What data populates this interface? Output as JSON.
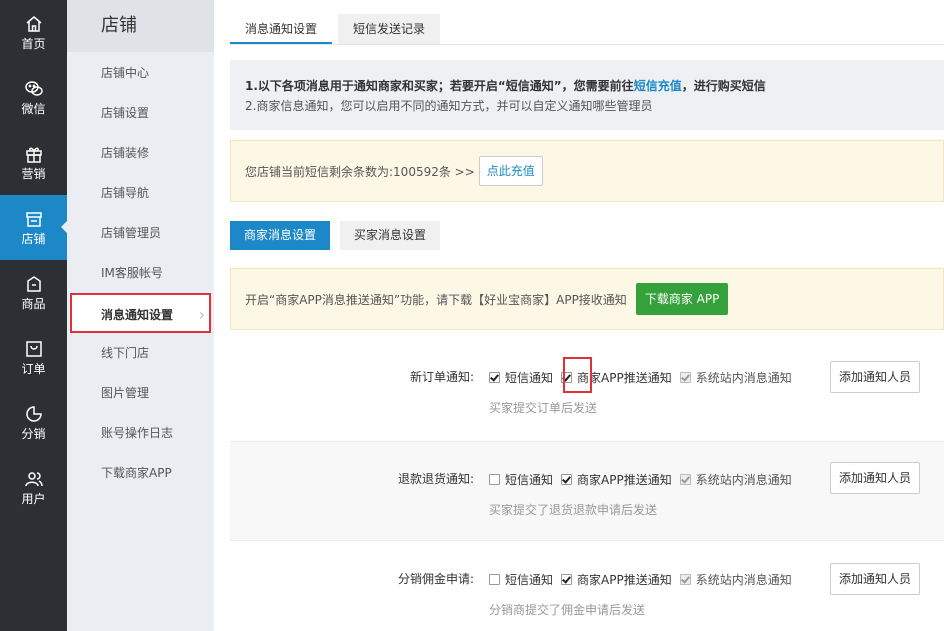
{
  "nav": [
    {
      "label": "首页",
      "icon": "home-icon"
    },
    {
      "label": "微信",
      "icon": "wechat-icon"
    },
    {
      "label": "营销",
      "icon": "gift-icon"
    },
    {
      "label": "店铺",
      "icon": "store-icon"
    },
    {
      "label": "商品",
      "icon": "bag-icon"
    },
    {
      "label": "订单",
      "icon": "order-icon"
    },
    {
      "label": "分销",
      "icon": "chart-icon"
    },
    {
      "label": "用户",
      "icon": "users-icon"
    }
  ],
  "submenu": {
    "title": "店铺",
    "items": [
      "店铺中心",
      "店铺设置",
      "店铺装修",
      "店铺导航",
      "店铺管理员",
      "IM客服帐号",
      "消息通知设置",
      "线下门店",
      "图片管理",
      "账号操作日志",
      "下载商家APP"
    ]
  },
  "tabs": [
    "消息通知设置",
    "短信发送记录"
  ],
  "notice": {
    "line1_a": "1.以下各项消息用于通知商家和买家；若要开启“短信通知”，您需要前往",
    "line1_link": "短信充值",
    "line1_b": "，进行购买短信",
    "line2": "2.商家信息通知，您可以启用不同的通知方式，并可以自定义通知哪些管理员"
  },
  "balance": {
    "text": "您店铺当前短信剩余条数为:100592条 >>",
    "button": "点此充值"
  },
  "subtabs": [
    "商家消息设置",
    "买家消息设置"
  ],
  "app_notice": {
    "text": "开启“商家APP消息推送通知”功能，请下载【好业宝商家】APP接收通知",
    "button": "下载商家 APP"
  },
  "option_labels": {
    "sms": "短信通知",
    "app": "商家APP推送通知",
    "site": "系统站内消息通知",
    "add": "添加通知人员"
  },
  "rows": [
    {
      "label": "新订单通知:",
      "hint": "买家提交订单后发送",
      "sms": true,
      "app": true,
      "site": true
    },
    {
      "label": "退款退货通知:",
      "hint": "买家提交了退货退款申请后发送",
      "sms": false,
      "app": true,
      "site": true
    },
    {
      "label": "分销佣金申请:",
      "hint": "分销商提交了佣金申请后发送",
      "sms": false,
      "app": true,
      "site": true
    }
  ],
  "colors": {
    "accent": "#1c88c7",
    "nav_bg": "#2c3035",
    "green": "#35a13a",
    "highlight": "#e0303a"
  }
}
